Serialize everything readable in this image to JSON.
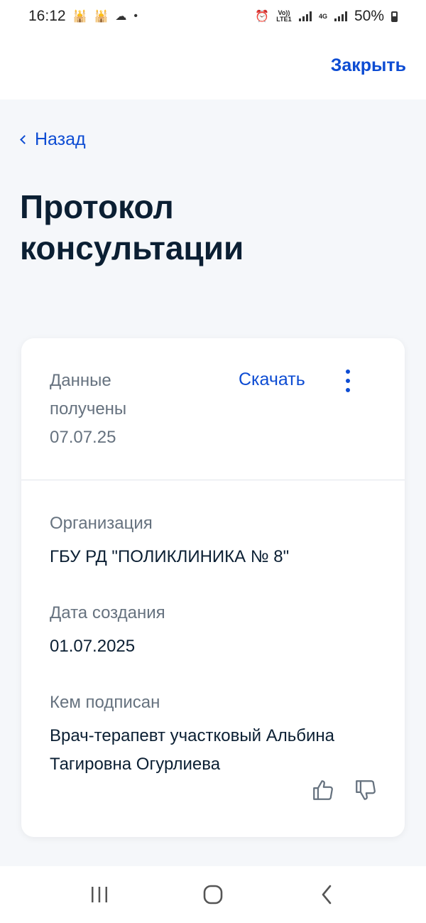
{
  "status_bar": {
    "time": "16:12",
    "battery": "50%",
    "network_label_1": "Vo)) LTE1",
    "network_label_2": "4G"
  },
  "header": {
    "close_label": "Закрыть"
  },
  "nav": {
    "back_label": "Назад"
  },
  "page": {
    "title": "Протокол консультации"
  },
  "card": {
    "received_label": "Данные получены",
    "received_date": "07.07.25",
    "download_label": "Скачать",
    "fields": [
      {
        "label": "Организация",
        "value": "ГБУ РД \"ПОЛИКЛИНИКА № 8\""
      },
      {
        "label": "Дата создания",
        "value": "01.07.2025"
      },
      {
        "label": "Кем подписан",
        "value": "Врач-терапевт участковый Альбина Тагировна Огурлиева"
      }
    ]
  },
  "colors": {
    "accent": "#0d4cd3",
    "text_primary": "#0b1f33",
    "text_secondary": "#66727f",
    "background": "#f5f7fa"
  }
}
